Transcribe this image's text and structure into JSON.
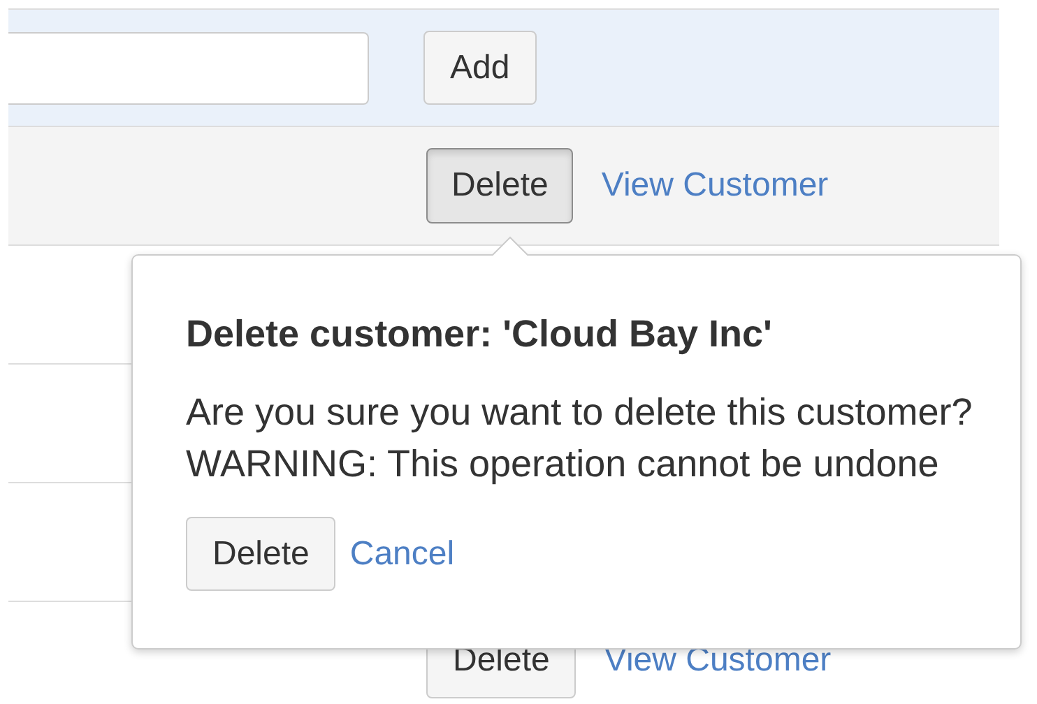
{
  "add_form": {
    "button": "Add"
  },
  "rows": [
    {
      "kind": "actions",
      "delete_label": "Delete",
      "pressed": true,
      "view_label": "View Customer"
    },
    {
      "kind": "blank"
    },
    {
      "kind": "blank"
    },
    {
      "kind": "blank"
    },
    {
      "kind": "actions",
      "delete_label": "Delete",
      "pressed": false,
      "view_label": "View Customer"
    }
  ],
  "popover": {
    "title": "Delete customer: 'Cloud Bay Inc'",
    "message": [
      "Are you sure you want to delete this customer?",
      "WARNING: This operation cannot be undone"
    ],
    "confirm": "Delete",
    "cancel": "Cancel"
  }
}
